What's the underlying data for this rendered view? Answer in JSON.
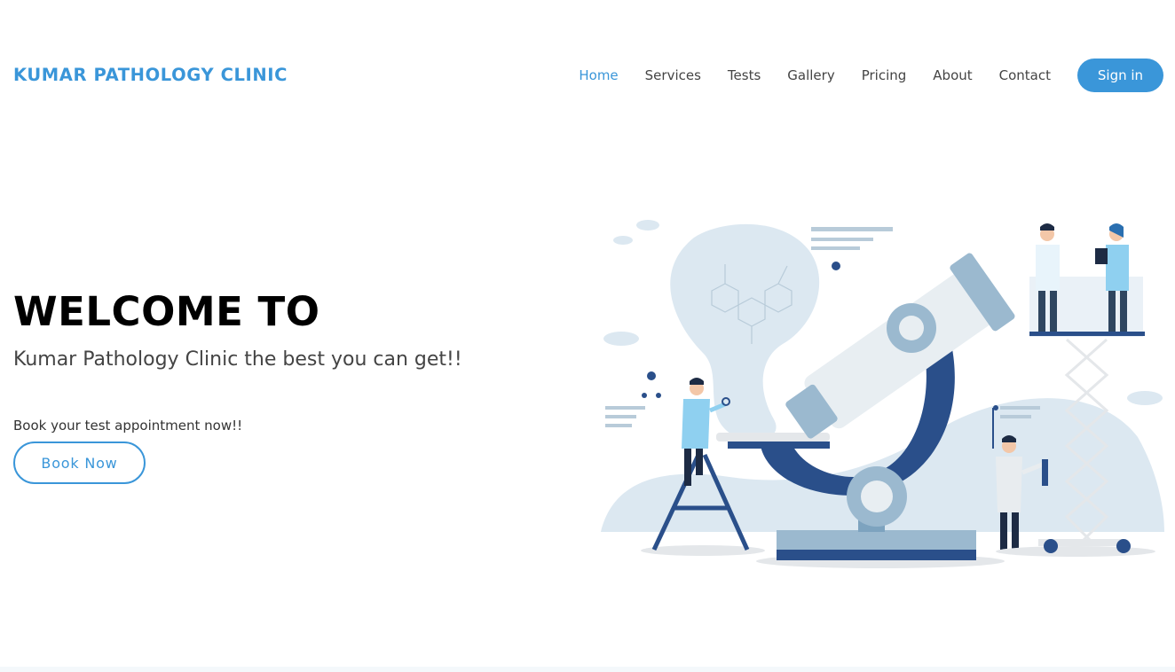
{
  "brand": {
    "name": "KUMAR PATHOLOGY CLINIC"
  },
  "nav": {
    "items": [
      {
        "label": "Home",
        "active": true
      },
      {
        "label": "Services",
        "active": false
      },
      {
        "label": "Tests",
        "active": false
      },
      {
        "label": "Gallery",
        "active": false
      },
      {
        "label": "Pricing",
        "active": false
      },
      {
        "label": "About",
        "active": false
      },
      {
        "label": "Contact",
        "active": false
      }
    ],
    "signin_label": "Sign in"
  },
  "hero": {
    "title": "WELCOME TO",
    "subtitle": "Kumar Pathology Clinic the best you can get!!",
    "cta_text": "Book your test appointment now!!",
    "button_label": "Book Now"
  },
  "colors": {
    "accent": "#3a96d9",
    "dark_blue": "#2a4f8a",
    "light_blue": "#dce8f1"
  },
  "illustration": {
    "icon": "laboratory-microscope-scientists-illustration"
  }
}
